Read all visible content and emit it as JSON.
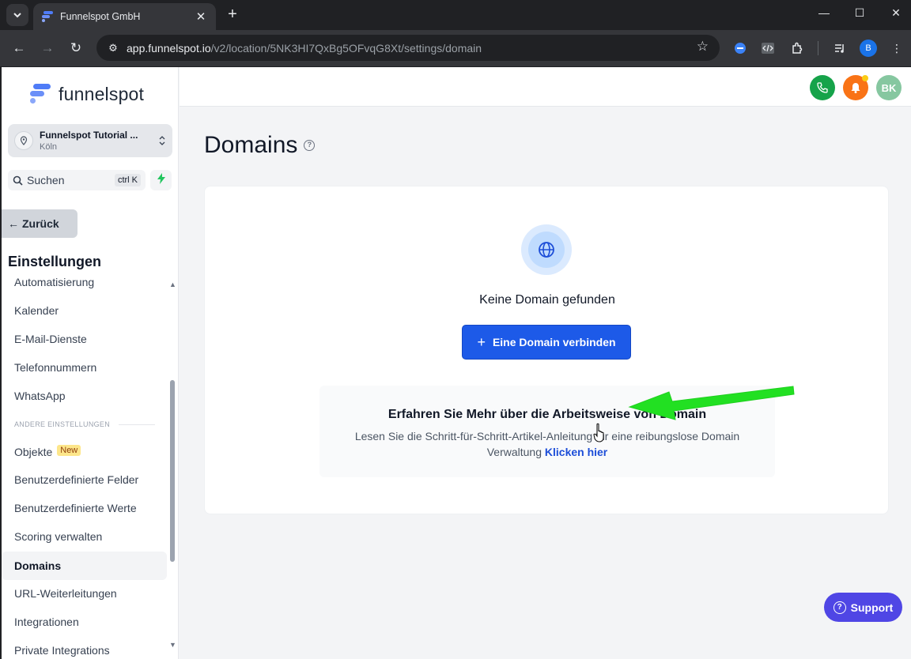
{
  "browser": {
    "tab_title": "Funnelspot GmbH",
    "url_host": "app.funnelspot.io",
    "url_path": "/v2/location/5NK3HI7QxBg5OFvqG8Xt/settings/domain",
    "profile_initial": "B"
  },
  "sidebar": {
    "logo_text": "funnelspot",
    "location": {
      "name": "Funnelspot Tutorial ...",
      "city": "Köln"
    },
    "search": {
      "label": "Suchen",
      "shortcut": "ctrl K"
    },
    "back_label": "Zurück",
    "settings_title": "Einstellungen",
    "items": [
      {
        "label": "Automatisierung"
      },
      {
        "label": "Kalender"
      },
      {
        "label": "E-Mail-Dienste"
      },
      {
        "label": "Telefonnummern"
      },
      {
        "label": "WhatsApp"
      }
    ],
    "section_label": "ANDERE EINSTELLUNGEN",
    "other_items": [
      {
        "label": "Objekte",
        "badge": "New"
      },
      {
        "label": "Benutzerdefinierte Felder"
      },
      {
        "label": "Benutzerdefinierte Werte"
      },
      {
        "label": "Scoring verwalten"
      },
      {
        "label": "Domains",
        "active": true
      },
      {
        "label": "URL-Weiterleitungen"
      },
      {
        "label": "Integrationen"
      },
      {
        "label": "Private Integrations"
      }
    ]
  },
  "topbar": {
    "avatar_initials": "BK"
  },
  "main": {
    "title": "Domains",
    "empty_text": "Keine Domain gefunden",
    "connect_button": "Eine Domain verbinden",
    "info": {
      "title": "Erfahren Sie Mehr über die Arbeitsweise von Domain",
      "desc": "Lesen Sie die Schritt-für-Schritt-Artikel-Anleitung für eine reibungslose Domain Verwaltung",
      "link": "Klicken hier"
    }
  },
  "support_label": "Support",
  "colors": {
    "primary": "#1d5ae8",
    "phone": "#16a34a",
    "bell": "#f97316",
    "avatar": "#86c7a0",
    "support": "#4f46e5",
    "arrow": "#22e022"
  }
}
